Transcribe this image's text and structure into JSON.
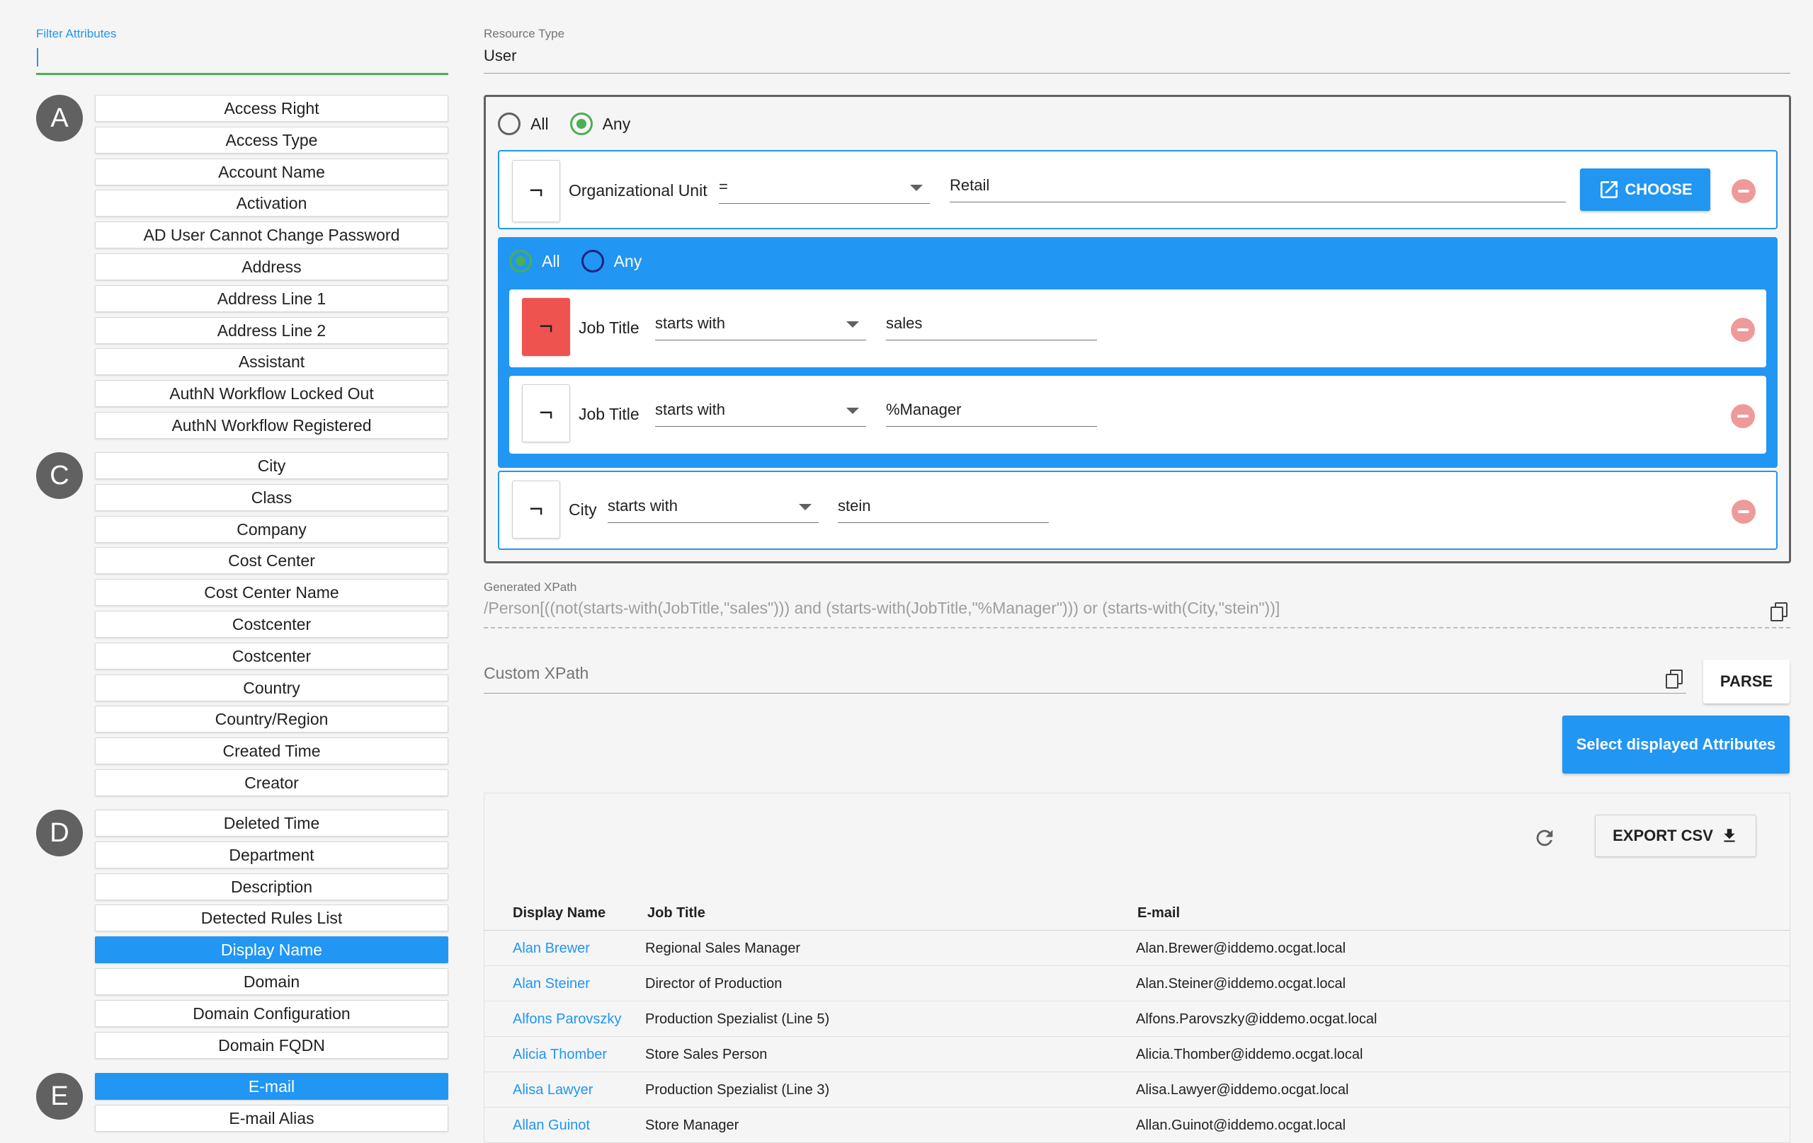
{
  "filter": {
    "label": "Filter Attributes",
    "value": ""
  },
  "attribute_groups": [
    {
      "letter": "A",
      "items": [
        "Access Right",
        "Access Type",
        "Account Name",
        "Activation",
        "AD User Cannot Change Password",
        "Address",
        "Address Line 1",
        "Address Line 2",
        "Assistant",
        "AuthN Workflow Locked Out",
        "AuthN Workflow Registered"
      ]
    },
    {
      "letter": "C",
      "items": [
        "City",
        "Class",
        "Company",
        "Cost Center",
        "Cost Center Name",
        "Costcenter",
        "Costcenter",
        "Country",
        "Country/Region",
        "Created Time",
        "Creator"
      ]
    },
    {
      "letter": "D",
      "items": [
        "Deleted Time",
        "Department",
        "Description",
        "Detected Rules List",
        "Display Name",
        "Domain",
        "Domain Configuration",
        "Domain FQDN"
      ]
    },
    {
      "letter": "E",
      "items": [
        "E-mail",
        "E-mail Alias"
      ]
    }
  ],
  "selected_attributes": [
    "Display Name",
    "E-mail"
  ],
  "resource_type": {
    "label": "Resource Type",
    "value": "User"
  },
  "builder": {
    "all_label": "All",
    "any_label": "Any",
    "top_mode": "Any",
    "not_symbol": "¬",
    "condition1": {
      "field": "Organizational Unit",
      "operator": "=",
      "value": "Retail",
      "choose_label": "CHOOSE"
    },
    "group": {
      "mode": "All",
      "conditions": [
        {
          "field": "Job Title",
          "operator": "starts with",
          "value": "sales",
          "negated": true
        },
        {
          "field": "Job Title",
          "operator": "starts with",
          "value": "%Manager",
          "negated": false
        }
      ]
    },
    "condition3": {
      "field": "City",
      "operator": "starts with",
      "value": "stein"
    }
  },
  "generated_xpath": {
    "label": "Generated XPath",
    "value": "/Person[((not(starts-with(JobTitle,\"sales\"))) and (starts-with(JobTitle,\"%Manager\"))) or (starts-with(City,\"stein\"))]"
  },
  "custom_xpath": {
    "placeholder": "Custom XPath",
    "parse_label": "PARSE"
  },
  "select_attributes_label": "Select displayed Attributes",
  "results": {
    "export_label": "EXPORT CSV",
    "columns": [
      "Display Name",
      "Job Title",
      "E-mail"
    ],
    "rows": [
      [
        "Alan Brewer",
        "Regional Sales Manager",
        "Alan.Brewer@iddemo.ocgat.local"
      ],
      [
        "Alan Steiner",
        "Director of Production",
        "Alan.Steiner@iddemo.ocgat.local"
      ],
      [
        "Alfons Parovszky",
        "Production Spezialist (Line 5)",
        "Alfons.Parovszky@iddemo.ocgat.local"
      ],
      [
        "Alicia Thomber",
        "Store Sales Person",
        "Alicia.Thomber@iddemo.ocgat.local"
      ],
      [
        "Alisa Lawyer",
        "Production Spezialist (Line 3)",
        "Alisa.Lawyer@iddemo.ocgat.local"
      ],
      [
        "Allan Guinot",
        "Store Manager",
        "Allan.Guinot@iddemo.ocgat.local"
      ]
    ]
  },
  "colors": {
    "accent": "#2196f3",
    "active_not": "#ef5350",
    "radio_on": "#4caf50",
    "remove": "#ef9a9a"
  }
}
